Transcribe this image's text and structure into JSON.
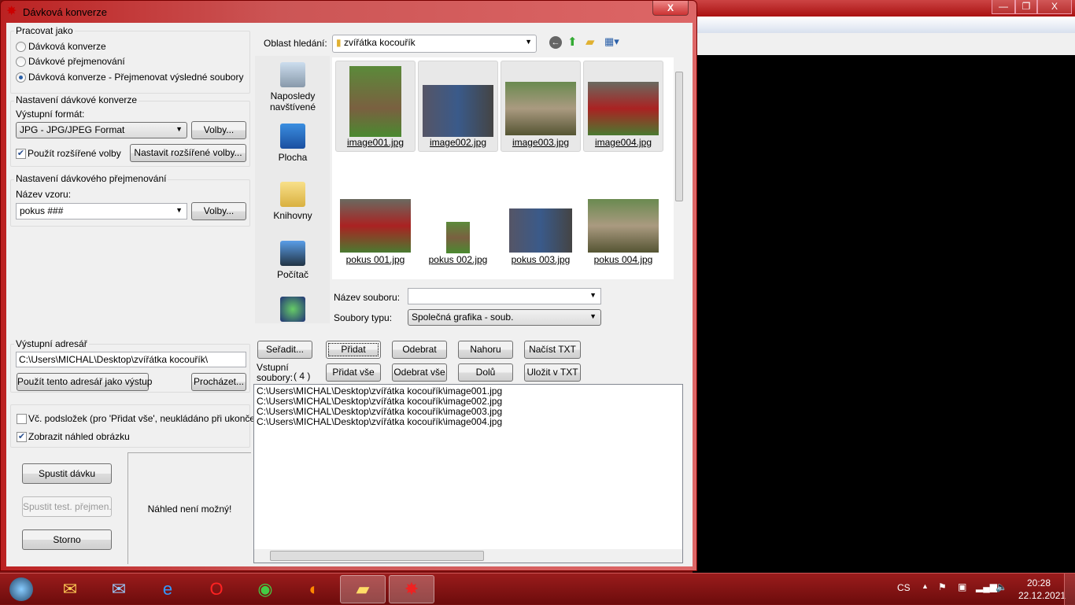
{
  "background_window": {
    "min": "—",
    "max": "❐",
    "close": "X"
  },
  "window": {
    "title": "Dávková konverze",
    "close": "X"
  },
  "work_as": {
    "label": "Pracovat jako",
    "options": [
      {
        "label": "Dávková konverze",
        "selected": false
      },
      {
        "label": "Dávkové přejmenování",
        "selected": false
      },
      {
        "label": "Dávková konverze - Přejmenovat výsledné soubory",
        "selected": true
      }
    ]
  },
  "conversion": {
    "label": "Nastavení dávkové konverze",
    "format_label": "Výstupní formát:",
    "format_value": "JPG - JPG/JPEG Format",
    "options_button": "Volby...",
    "advanced_checkbox": "Použít rozšířené volby",
    "advanced_checked": true,
    "advanced_button": "Nastavit rozšířené volby..."
  },
  "rename": {
    "label": "Nastavení dávkového přejmenování",
    "pattern_label": "Název vzoru:",
    "pattern_value": "pokus ###",
    "options_button": "Volby..."
  },
  "output": {
    "label": "Výstupní adresář",
    "path": "C:\\Users\\MICHAL\\Desktop\\zvířátka kocouřík\\",
    "use_button": "Použít tento adresář jako výstup",
    "browse_button": "Procházet..."
  },
  "subfolders": {
    "label": "Vč. podsložek (pro 'Přidat vše', neukládáno při ukončení)",
    "checked": false
  },
  "preview_chk": {
    "label": "Zobrazit náhled obrázku",
    "checked": true
  },
  "actions": {
    "start": "Spustit dávku",
    "test": "Spustit test. přejmen.",
    "cancel": "Storno"
  },
  "preview_text": "Náhled není možný!",
  "browser": {
    "location_label": "Oblast hledání:",
    "location_value": "zvířátka kocouřík",
    "places": [
      {
        "label": "Naposledy navštívené",
        "icon": "recent-places-icon"
      },
      {
        "label": "Plocha",
        "icon": "desktop-icon"
      },
      {
        "label": "Knihovny",
        "icon": "libraries-icon"
      },
      {
        "label": "Počítač",
        "icon": "computer-icon"
      },
      {
        "label": "",
        "icon": "network-icon"
      }
    ],
    "files": [
      {
        "name": "image001.jpg"
      },
      {
        "name": "image002.jpg"
      },
      {
        "name": "image003.jpg"
      },
      {
        "name": "image004.jpg"
      },
      {
        "name": "pokus 001.jpg"
      },
      {
        "name": "pokus 002.jpg"
      },
      {
        "name": "pokus 003.jpg"
      },
      {
        "name": "pokus 004.jpg"
      }
    ],
    "filename_label": "Název souboru:",
    "filename_value": "",
    "filetype_label": "Soubory typu:",
    "filetype_value": "Společná grafika - soub."
  },
  "buttons": {
    "sort": "Seřadit...",
    "add": "Přidat",
    "remove": "Odebrat",
    "up": "Nahoru",
    "load_txt": "Načíst TXT",
    "add_all": "Přidat vše",
    "remove_all": "Odebrat vše",
    "down": "Dolů",
    "save_txt": "Uložit v TXT"
  },
  "input_files": {
    "label": "Vstupní soubory:",
    "count": "( 4 )",
    "items": [
      "C:\\Users\\MICHAL\\Desktop\\zvířátka kocouřík\\image001.jpg",
      "C:\\Users\\MICHAL\\Desktop\\zvířátka kocouřík\\image002.jpg",
      "C:\\Users\\MICHAL\\Desktop\\zvířátka kocouřík\\image003.jpg",
      "C:\\Users\\MICHAL\\Desktop\\zvířátka kocouřík\\image004.jpg"
    ]
  },
  "taskbar": {
    "lang": "CS",
    "time": "20:28",
    "date": "22.12.2021"
  }
}
